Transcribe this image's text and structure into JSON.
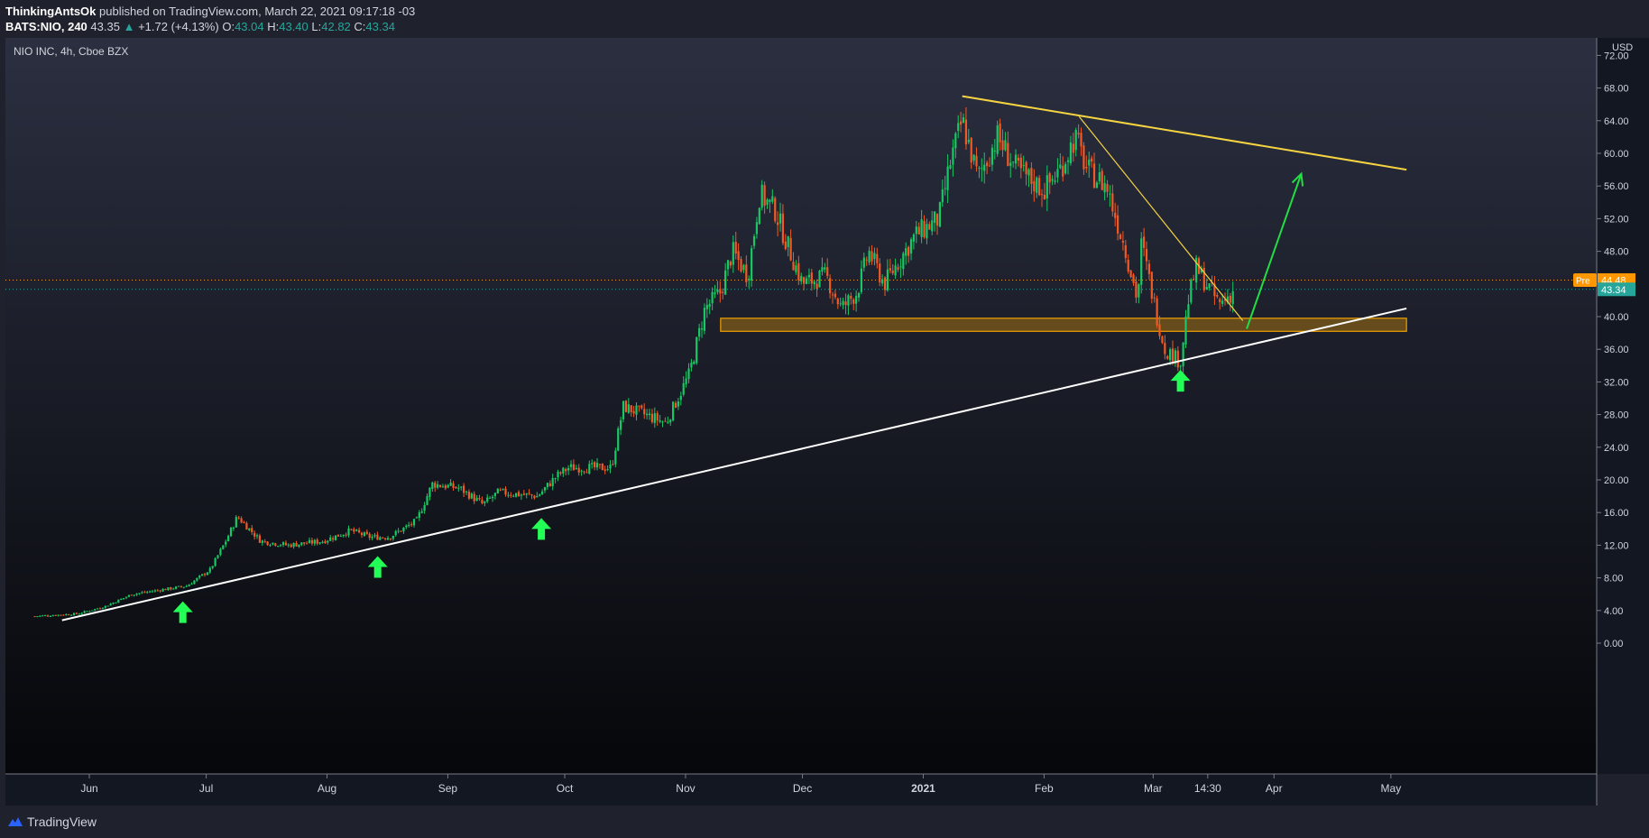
{
  "header": {
    "author": "ThinkingAntsOk",
    "published_text": "published on TradingView.com, March 22, 2021 09:17:18 -03",
    "symbol": "BATS:NIO, 240",
    "last": "43.35",
    "change_arrow": "▲",
    "change": "+1.72 (+4.13%)",
    "o_label": "O:",
    "o_val": "43.04",
    "h_label": "H:",
    "h_val": "43.40",
    "l_label": "L:",
    "l_val": "42.82",
    "c_label": "C:",
    "c_val": "43.34"
  },
  "chart": {
    "legend_title": "NIO INC, 4h, Cboe BZX",
    "currency": "USD",
    "pre_label": "Pre",
    "pre_price": "44.48",
    "last_price": "43.34"
  },
  "footer": {
    "brand": "TradingView"
  },
  "colors": {
    "up": "#26a69a",
    "up_bright": "#18c864",
    "down": "#f15a24",
    "trendline_upper": "#f5d442",
    "support_line": "#ffffff",
    "zone": "#f0a000",
    "projection_arrow": "#22dd44",
    "bounce_arrows": "#22ff55",
    "pre_badge": "#ff9800",
    "last_badge": "#26a69a"
  },
  "chart_data": {
    "type": "candlestick",
    "title": "NIO INC, 4h, Cboe BZX",
    "ylabel": "USD",
    "ylim": [
      -2,
      74
    ],
    "y_ticks": [
      "72.00",
      "68.00",
      "64.00",
      "60.00",
      "56.00",
      "52.00",
      "48.00",
      "44.00",
      "40.00",
      "36.00",
      "32.00",
      "28.00",
      "24.00",
      "20.00",
      "16.00",
      "12.00",
      "8.00",
      "4.00",
      "0.00"
    ],
    "x_ticks": [
      "Jun",
      "Jul",
      "Aug",
      "Sep",
      "Oct",
      "Nov",
      "Dec",
      "2021",
      "Feb",
      "Mar",
      "14:30",
      "Apr",
      "May"
    ],
    "grid": false,
    "price_path": [
      [
        "2020-05-18",
        3.3
      ],
      [
        "2020-05-29",
        3.6
      ],
      [
        "2020-06-05",
        4.5
      ],
      [
        "2020-06-12",
        6.0
      ],
      [
        "2020-06-26",
        7.0
      ],
      [
        "2020-07-02",
        9.0
      ],
      [
        "2020-07-06",
        12.5
      ],
      [
        "2020-07-09",
        15.5
      ],
      [
        "2020-07-15",
        12.5
      ],
      [
        "2020-07-22",
        12.0
      ],
      [
        "2020-07-31",
        12.5
      ],
      [
        "2020-08-07",
        13.8
      ],
      [
        "2020-08-12",
        13.0
      ],
      [
        "2020-08-17",
        13.0
      ],
      [
        "2020-08-24",
        15.0
      ],
      [
        "2020-08-28",
        19.5
      ],
      [
        "2020-09-04",
        19.0
      ],
      [
        "2020-09-10",
        17.0
      ],
      [
        "2020-09-14",
        18.5
      ],
      [
        "2020-09-24",
        18.0
      ],
      [
        "2020-09-29",
        20.5
      ],
      [
        "2020-10-02",
        21.5
      ],
      [
        "2020-10-13",
        21.5
      ],
      [
        "2020-10-14",
        24.0
      ],
      [
        "2020-10-16",
        29.0
      ],
      [
        "2020-10-27",
        27.0
      ],
      [
        "2020-11-02",
        33.0
      ],
      [
        "2020-11-06",
        41.0
      ],
      [
        "2020-11-10",
        43.0
      ],
      [
        "2020-11-13",
        48.0
      ],
      [
        "2020-11-17",
        45.0
      ],
      [
        "2020-11-20",
        55.0
      ],
      [
        "2020-11-24",
        53.0
      ],
      [
        "2020-11-27",
        49.0
      ],
      [
        "2020-12-01",
        44.0
      ],
      [
        "2020-12-07",
        45.0
      ],
      [
        "2020-12-11",
        41.0
      ],
      [
        "2020-12-15",
        43.0
      ],
      [
        "2020-12-18",
        48.0
      ],
      [
        "2020-12-22",
        44.0
      ],
      [
        "2020-12-30",
        50.0
      ],
      [
        "2021-01-05",
        52.0
      ],
      [
        "2021-01-08",
        59.0
      ],
      [
        "2021-01-11",
        64.0
      ],
      [
        "2021-01-15",
        57.0
      ],
      [
        "2021-01-20",
        62.0
      ],
      [
        "2021-01-25",
        58.0
      ],
      [
        "2021-02-01",
        55.5
      ],
      [
        "2021-02-05",
        58.0
      ],
      [
        "2021-02-09",
        62.0
      ],
      [
        "2021-02-12",
        58.0
      ],
      [
        "2021-02-17",
        56.0
      ],
      [
        "2021-02-22",
        48.0
      ],
      [
        "2021-02-25",
        42.0
      ],
      [
        "2021-02-26",
        49.0
      ],
      [
        "2021-03-02",
        40.0
      ],
      [
        "2021-03-04",
        36.0
      ],
      [
        "2021-03-08",
        34.5
      ],
      [
        "2021-03-10",
        42.0
      ],
      [
        "2021-03-12",
        46.0
      ],
      [
        "2021-03-16",
        43.0
      ],
      [
        "2021-03-18",
        41.5
      ],
      [
        "2021-03-22",
        43.3
      ]
    ],
    "horizontal_lines": [
      {
        "price": 44.48,
        "label": "Pre"
      },
      {
        "price": 43.34,
        "label": "Last"
      }
    ],
    "drawings": {
      "support_trendline": {
        "from": [
          "2020-05-25",
          2.8
        ],
        "to": [
          "2021-05-05",
          41.0
        ]
      },
      "upper_trendline": {
        "from": [
          "2021-01-11",
          67.0
        ],
        "to": [
          "2021-05-05",
          58.0
        ]
      },
      "wedge_trendline": {
        "from": [
          "2021-02-10",
          64.5
        ],
        "to": [
          "2021-03-24",
          39.5
        ]
      },
      "support_zone": {
        "from_date": "2020-11-10",
        "to_date": "2021-05-05",
        "low": 38.2,
        "high": 39.8
      },
      "projection_arrow": {
        "from": [
          "2021-03-25",
          38.5
        ],
        "to": [
          "2021-04-08",
          57.5
        ]
      },
      "bounce_arrows": [
        "2020-06-25",
        "2020-08-14",
        "2020-09-25",
        "2021-03-08"
      ]
    }
  }
}
